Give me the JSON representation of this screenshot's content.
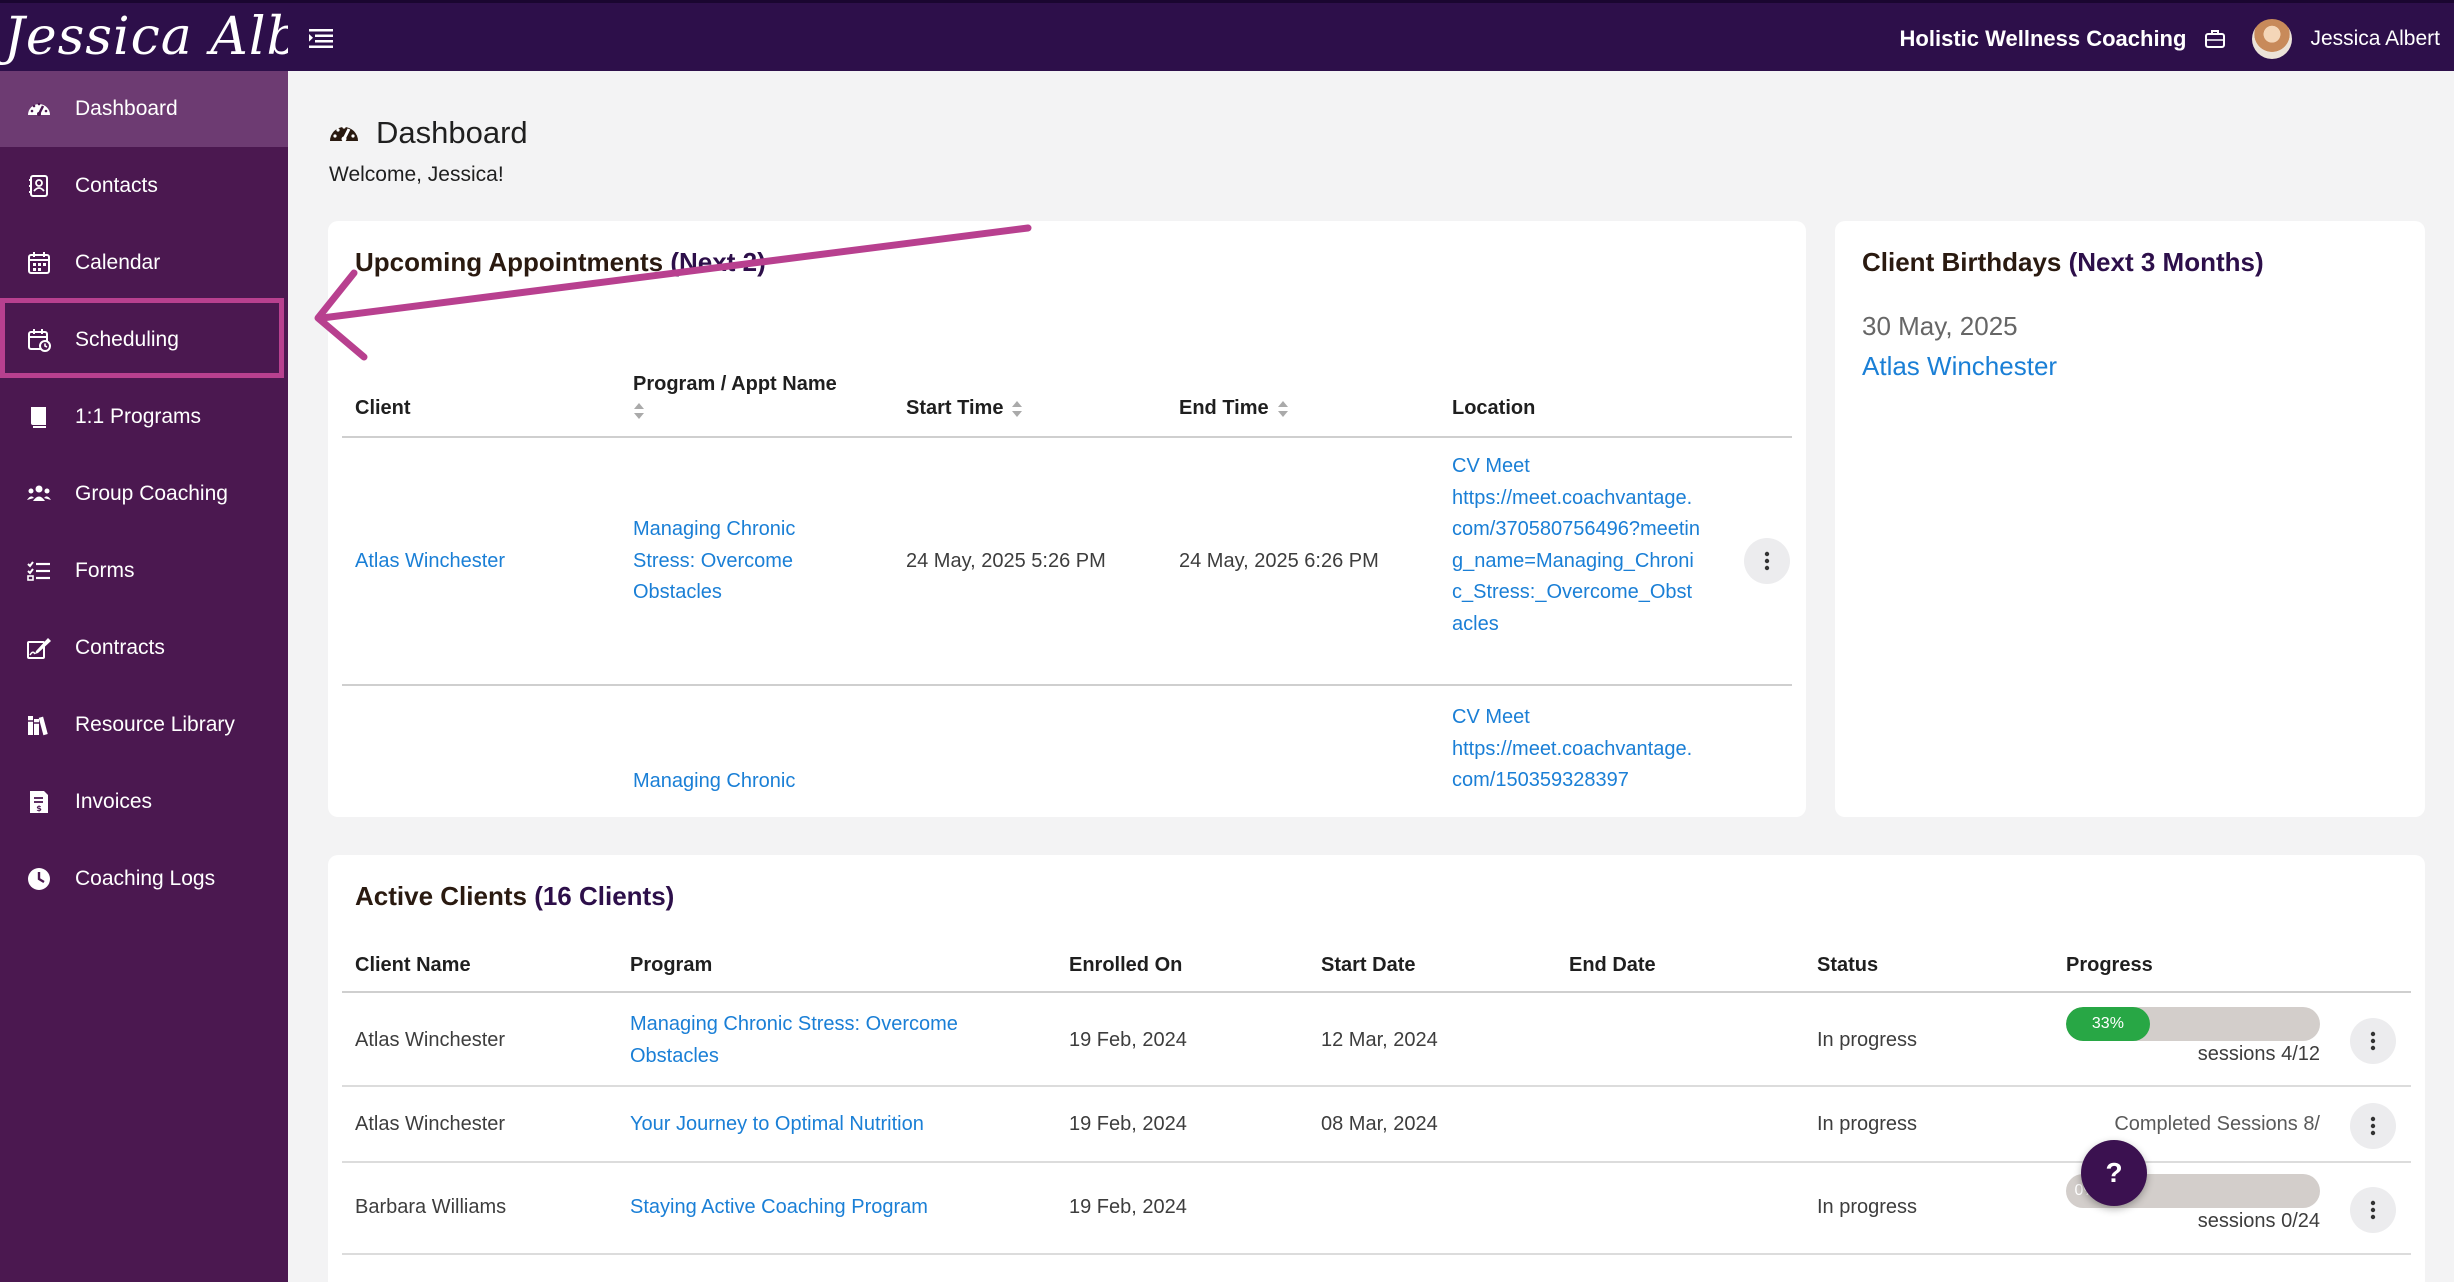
{
  "app": {
    "logo_text": "Jessica Albert",
    "org_name": "Holistic Wellness Coaching",
    "user_name": "Jessica Albert"
  },
  "sidebar": {
    "items": [
      {
        "label": "Dashboard",
        "icon": "gauge-icon",
        "active": true
      },
      {
        "label": "Contacts",
        "icon": "contact-book-icon"
      },
      {
        "label": "Calendar",
        "icon": "calendar-icon"
      },
      {
        "label": "Scheduling",
        "icon": "scheduling-icon"
      },
      {
        "label": "1:1 Programs",
        "icon": "book-icon"
      },
      {
        "label": "Group Coaching",
        "icon": "users-icon"
      },
      {
        "label": "Forms",
        "icon": "list-check-icon"
      },
      {
        "label": "Contracts",
        "icon": "signature-icon"
      },
      {
        "label": "Resource Library",
        "icon": "library-icon"
      },
      {
        "label": "Invoices",
        "icon": "invoice-icon"
      },
      {
        "label": "Coaching Logs",
        "icon": "clock-icon"
      }
    ]
  },
  "page": {
    "title": "Dashboard",
    "welcome": "Welcome, Jessica!"
  },
  "appointments": {
    "title": "Upcoming Appointments",
    "title_accent": "(Next 2)",
    "columns": [
      "Client",
      "Program / Appt Name",
      "Start Time",
      "End Time",
      "Location"
    ],
    "rows": [
      {
        "client": "Atlas Winchester",
        "program": "Managing Chronic Stress: Overcome Obstacles",
        "start": "24 May, 2025 5:26 PM",
        "end": "24 May, 2025 6:26 PM",
        "location_name": "CV Meet",
        "location_url": "https://meet.coachvantage.com/370580756496?meeting_name=Managing_Chronic_Stress:_Overcome_Obstacles"
      },
      {
        "client": "",
        "program": "Managing Chronic",
        "start": "",
        "end": "",
        "location_name": "CV Meet",
        "location_url": "https://meet.coachvantage.com/150359328397"
      }
    ]
  },
  "birthdays": {
    "title": "Client Birthdays",
    "title_accent": "(Next 3 Months)",
    "date": "30 May, 2025",
    "name": "Atlas Winchester"
  },
  "active_clients": {
    "title": "Active Clients",
    "title_accent": "(16 Clients)",
    "columns": [
      "Client Name",
      "Program",
      "Enrolled On",
      "Start Date",
      "End Date",
      "Status",
      "Progress"
    ],
    "rows": [
      {
        "name": "Atlas Winchester",
        "program": "Managing Chronic Stress: Overcome Obstacles",
        "enrolled": "19 Feb, 2024",
        "start": "12 Mar, 2024",
        "end": "",
        "status": "In progress",
        "progress_label": "33%",
        "progress": 0.33,
        "sessions": "sessions 4/12"
      },
      {
        "name": "Atlas Winchester",
        "program": "Your Journey to Optimal Nutrition",
        "enrolled": "19 Feb, 2024",
        "start": "08 Mar, 2024",
        "end": "",
        "status": "In progress",
        "sessions": "Completed Sessions 8/"
      },
      {
        "name": "Barbara Williams",
        "program": "Staying Active Coaching Program",
        "enrolled": "19 Feb, 2024",
        "start": "",
        "end": "",
        "status": "In progress",
        "progress_label": "0%",
        "progress": 0,
        "sessions": "sessions 0/24"
      }
    ]
  },
  "help_button": "?",
  "colors": {
    "topbar": "#2d0f4a",
    "sidebar": "#4b1850",
    "sidebar_active": "#6d3b72",
    "link": "#1a7fd6",
    "annotation": "#b8408f",
    "progress": "#28a745"
  }
}
